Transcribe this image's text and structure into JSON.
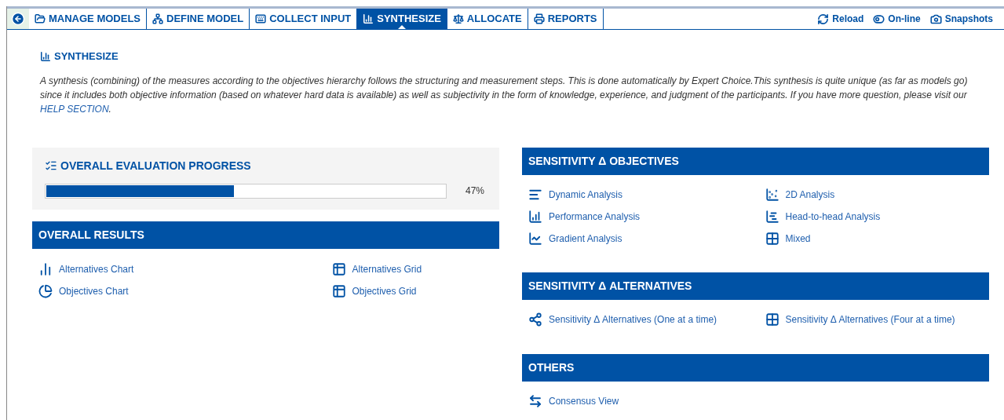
{
  "tabs": [
    {
      "label": "MANAGE MODELS",
      "selected": false
    },
    {
      "label": "DEFINE MODEL",
      "selected": false
    },
    {
      "label": "COLLECT INPUT",
      "selected": false
    },
    {
      "label": "SYNTHESIZE",
      "selected": true
    },
    {
      "label": "ALLOCATE",
      "selected": false
    },
    {
      "label": "REPORTS",
      "selected": false
    }
  ],
  "toolbar": [
    "Reload",
    "On-line",
    "Snapshots"
  ],
  "page": {
    "title": "SYNTHESIZE",
    "description": "A synthesis (combining) of the measures according to the objectives hierarchy follows the structuring and measurement steps. This is done automatically by Expert Choice.This synthesis is quite unique (as far as models go) since it includes both objective information (based on whatever hard data is available) as well as subjectivity in the form of knowledge, experience, and judgment of the participants. If you have more question, please visit our",
    "help_link": "HELP SECTION",
    "end": "."
  },
  "progress": {
    "title": "OVERALL EVALUATION PROGRESS",
    "level": 0.47,
    "reading": "47%"
  },
  "overall_results": {
    "title": "OVERALL RESULTS",
    "items": [
      "Alternatives Chart",
      "Alternatives Grid",
      "Objectives Chart",
      "Objectives Grid"
    ]
  },
  "sensitivity_objectives": {
    "title": "SENSITIVITY Δ OBJECTIVES",
    "items": [
      "Dynamic Analysis",
      "2D Analysis",
      "Performance Analysis",
      "Head-to-head Analysis",
      "Gradient Analysis",
      "Mixed"
    ]
  },
  "sensitivity_alternatives": {
    "title": "SENSITIVITY Δ ALTERNATIVES",
    "items": [
      "Sensitivity Δ Alternatives (One at a time)",
      "Sensitivity Δ Alternatives (Four at a time)"
    ]
  },
  "others": {
    "title": "OTHERS",
    "items": [
      "Consensus View"
    ]
  }
}
